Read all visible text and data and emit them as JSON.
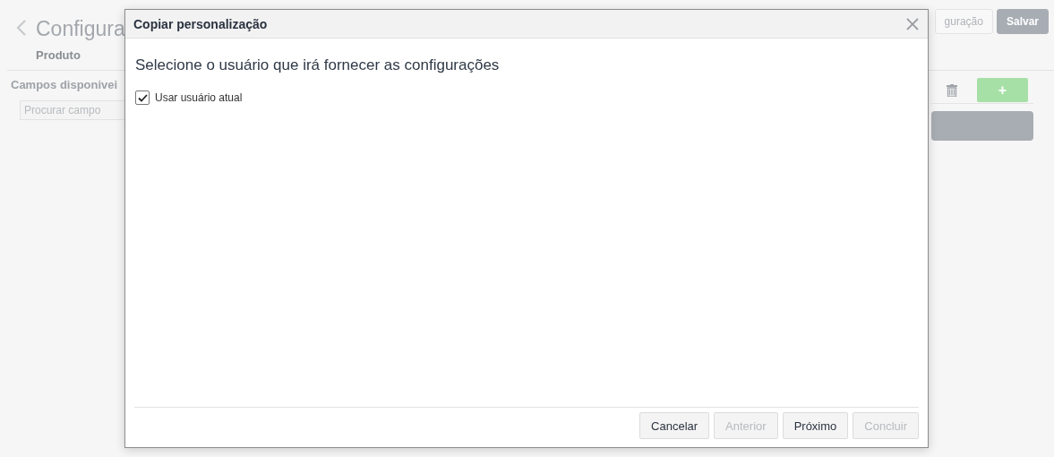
{
  "page": {
    "title": "Configura",
    "subtitle": "Produto",
    "section_title": "Campos disponivei",
    "search": {
      "placeholder": "Procurar campo"
    },
    "header_buttons": [
      {
        "label": "guração",
        "kind": "default"
      },
      {
        "label": "Salvar",
        "kind": "primary"
      }
    ],
    "add_button": {
      "label": "+"
    }
  },
  "dialog": {
    "title": "Copiar personalização",
    "heading": "Selecione o usuário que irá fornecer as configurações",
    "checkbox": {
      "label": "Usar usuário atual",
      "checked": true
    },
    "buttons": [
      {
        "label": "Cancelar",
        "disabled": false
      },
      {
        "label": "Anterior",
        "disabled": true
      },
      {
        "label": "Próximo",
        "disabled": false
      },
      {
        "label": "Concluir",
        "disabled": true
      }
    ]
  }
}
